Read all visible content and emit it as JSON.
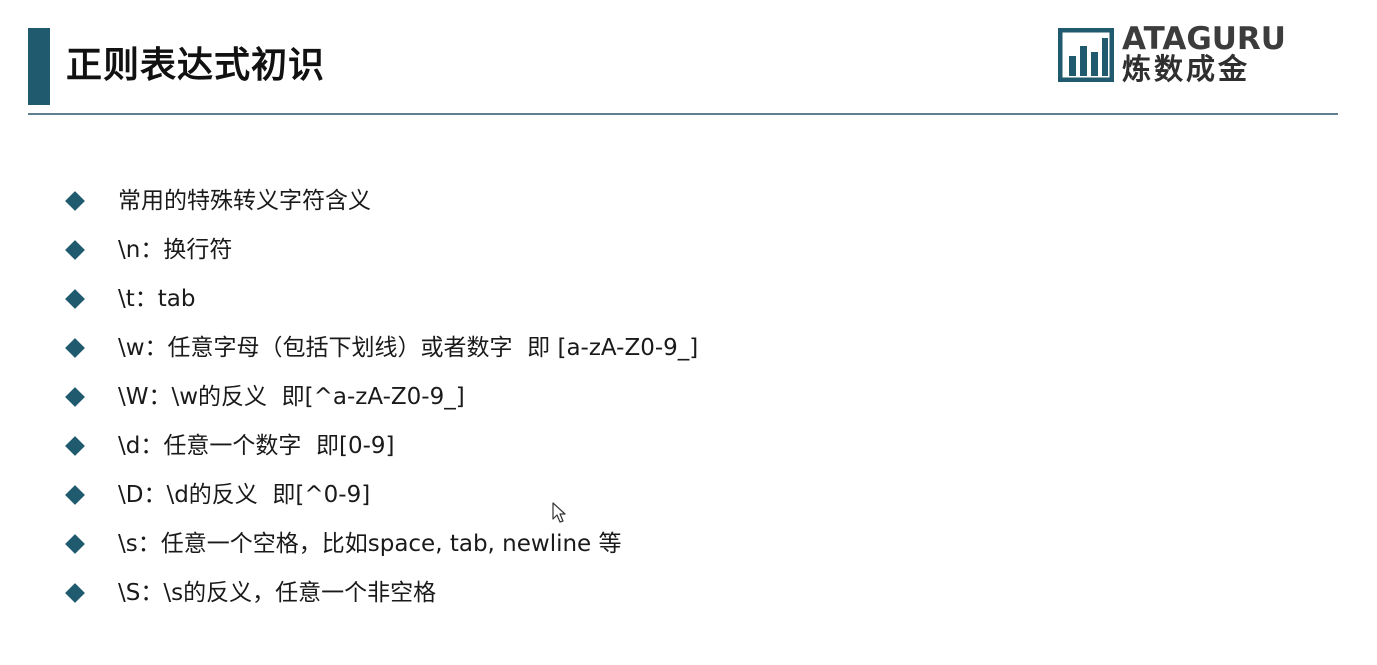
{
  "slide": {
    "title": "正则表达式初识",
    "logo": {
      "wordmark": "ATAGURU",
      "chinese": "炼数成金"
    },
    "bullets": [
      "常用的特殊转义字符含义",
      "\\n：换行符",
      "\\t：tab",
      "\\w：任意字母（包括下划线）或者数字  即 [a-zA-Z0-9_]",
      "\\W：\\w的反义  即[^a-zA-Z0-9_]",
      "\\d：任意一个数字  即[0-9]",
      "\\D：\\d的反义  即[^0-9]",
      "\\s：任意一个空格，比如space, tab, newline 等",
      "\\S：\\s的反义，任意一个非空格"
    ]
  },
  "colors": {
    "accent": "#1f5a6e",
    "rule": "#5f7f93"
  },
  "icons": {
    "bullet": "diamond-icon",
    "cursor": "mouse-pointer-icon"
  }
}
